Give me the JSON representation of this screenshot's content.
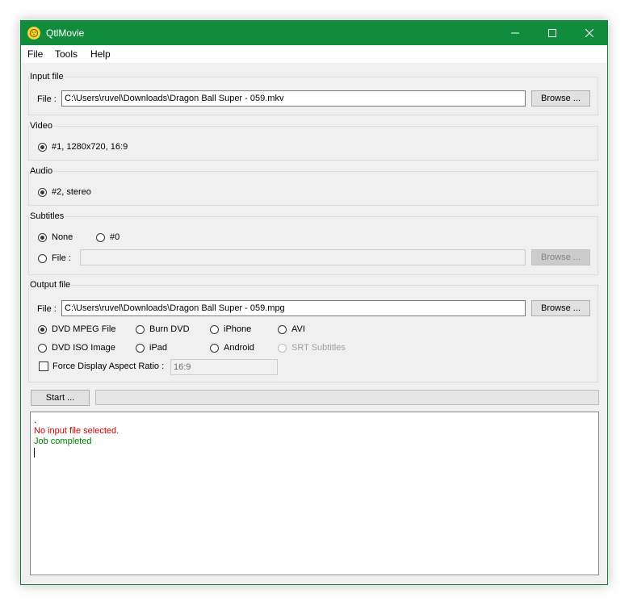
{
  "window": {
    "title": "QtlMovie"
  },
  "menu": {
    "file": "File",
    "tools": "Tools",
    "help": "Help"
  },
  "input_group": {
    "title": "Input file",
    "file_label": "File :",
    "file_value": "C:\\Users\\ruvel\\Downloads\\Dragon Ball Super - 059.mkv",
    "browse_label": "Browse ..."
  },
  "video_group": {
    "title": "Video",
    "track": {
      "label": "#1, 1280x720, 16:9",
      "selected": true
    }
  },
  "audio_group": {
    "title": "Audio",
    "track": {
      "label": "#2, stereo",
      "selected": true
    }
  },
  "subtitles_group": {
    "title": "Subtitles",
    "none_label": "None",
    "track0_label": "#0",
    "file_label": "File :",
    "file_value": "",
    "browse_label": "Browse ...",
    "selected": "None"
  },
  "output_group": {
    "title": "Output file",
    "file_label": "File :",
    "file_value": "C:\\Users\\ruvel\\Downloads\\Dragon Ball Super - 059.mpg",
    "browse_label": "Browse ...",
    "formats": {
      "dvd_mpeg": "DVD MPEG File",
      "burn_dvd": "Burn DVD",
      "iphone": "iPhone",
      "avi": "AVI",
      "dvd_iso": "DVD ISO Image",
      "ipad": "iPad",
      "android": "Android",
      "srt": "SRT Subtitles"
    },
    "selected_format": "DVD MPEG File",
    "force_aspect_label": "Force Display Aspect Ratio :",
    "force_aspect_checked": false,
    "aspect_value": "16:9"
  },
  "controls": {
    "start_label": "Start ...",
    "progress": 0
  },
  "log": {
    "lines": [
      {
        "text": ".",
        "color": "#000000"
      },
      {
        "text": "No input file selected.",
        "color": "#d40000"
      },
      {
        "text": "Job completed",
        "color": "#008000"
      }
    ]
  },
  "colors": {
    "titlebar": "#108c3c",
    "error": "#d40000",
    "success": "#008000",
    "progress_fill": "#06b025"
  }
}
